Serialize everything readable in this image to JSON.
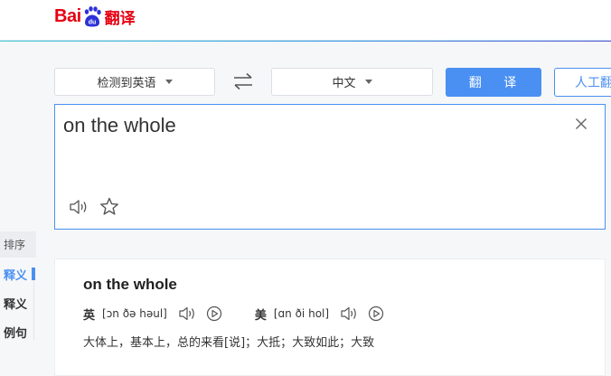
{
  "brand": {
    "logo_text": "Baidu",
    "logo_bai": "Bai",
    "logo_du": "du",
    "product": "翻译",
    "brand_color": "#e60012"
  },
  "toolbar": {
    "source_language": "检测到英语",
    "target_language": "中文",
    "swap_icon": "swap-arrows-icon",
    "translate_label": "翻 译",
    "human_translate_label": "人工翻",
    "accent_color": "#4a90f2"
  },
  "input": {
    "text": "on the whole",
    "clear_icon": "close-icon",
    "sound_icon": "speaker-icon",
    "favorite_icon": "star-icon"
  },
  "sidebar": {
    "sort_label": "排序",
    "items": [
      {
        "label": "释义",
        "active": true
      },
      {
        "label": "释义",
        "active": false
      },
      {
        "label": "例句",
        "active": false
      }
    ]
  },
  "result": {
    "word": "on the whole",
    "uk_label": "英",
    "uk_phonetic": "[ɔn ðə həul]",
    "us_label": "美",
    "us_phonetic": "[ɑn ði hol]",
    "meaning": "大体上，基本上，总的来看[说]；大抵；大致如此；大致"
  }
}
